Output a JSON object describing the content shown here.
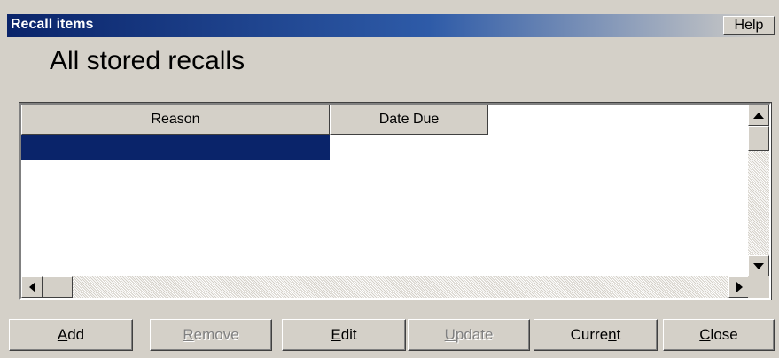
{
  "window": {
    "title": "Recall items",
    "help_label": "Help"
  },
  "heading": "All stored recalls",
  "table": {
    "columns": [
      "Reason",
      "Date Due"
    ],
    "rows": [
      {
        "reason": "",
        "date_due": "",
        "selected": true
      }
    ]
  },
  "buttons": [
    {
      "label": "Add",
      "mnemonic": "A",
      "enabled": true
    },
    {
      "label": "Remove",
      "mnemonic": "R",
      "enabled": false
    },
    {
      "label": "Edit",
      "mnemonic": "E",
      "enabled": true
    },
    {
      "label": "Update",
      "mnemonic": "U",
      "enabled": false
    },
    {
      "label": "Current",
      "mnemonic": "n",
      "enabled": true
    },
    {
      "label": "Close",
      "mnemonic": "C",
      "enabled": true
    }
  ],
  "colors": {
    "titlebar_start": "#0a246a",
    "selection": "#0a246a",
    "face": "#d4d0c8"
  }
}
